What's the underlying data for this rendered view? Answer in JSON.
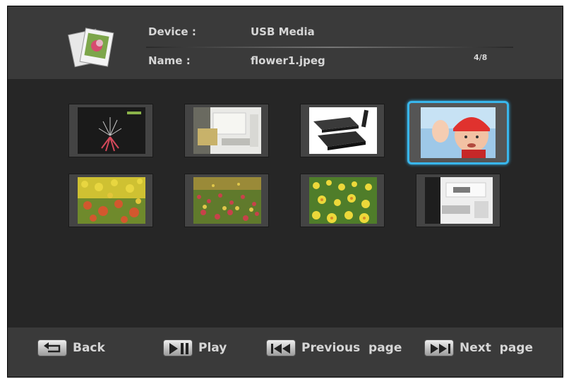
{
  "header": {
    "device_label": "Device :",
    "device_value": "USB Media",
    "name_label": "Name :",
    "name_value": "flower1.jpeg",
    "counter": "4/8"
  },
  "thumbnails": [
    {
      "icon": "fireworks",
      "selected": false
    },
    {
      "icon": "interior-room",
      "selected": false
    },
    {
      "icon": "media-player-device",
      "selected": false
    },
    {
      "icon": "baby-portrait",
      "selected": true
    },
    {
      "icon": "yellow-red-flowers",
      "selected": false
    },
    {
      "icon": "flower-field",
      "selected": false
    },
    {
      "icon": "yellow-flowers",
      "selected": false
    },
    {
      "icon": "modern-room",
      "selected": false
    }
  ],
  "footer": {
    "back_label": "Back",
    "play_label": "Play",
    "previous_label": "Previous  page",
    "next_label": "Next  page"
  },
  "colors": {
    "screen_bg": "#262626",
    "bar_bg": "#3a3a3a",
    "text": "#d6d6d6",
    "selection": "#39b6ec"
  }
}
